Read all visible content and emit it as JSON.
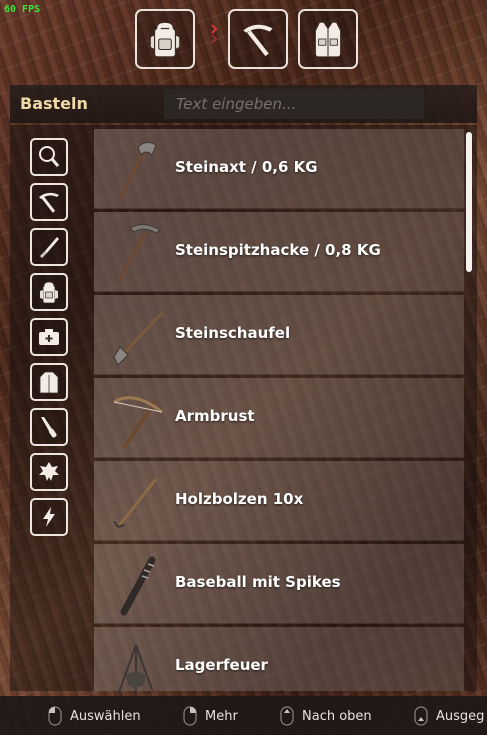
{
  "fps": "60 FPS",
  "tabs": [
    {
      "name": "backpack-icon"
    },
    {
      "name": "pickaxe-icon"
    },
    {
      "name": "vest-icon"
    }
  ],
  "panel": {
    "title": "Basteln",
    "search_placeholder": "Text eingeben..."
  },
  "categories": [
    {
      "name": "search-icon"
    },
    {
      "name": "tools-icon"
    },
    {
      "name": "knife-icon"
    },
    {
      "name": "backpack-icon"
    },
    {
      "name": "medkit-icon"
    },
    {
      "name": "jacket-icon"
    },
    {
      "name": "screwdriver-icon"
    },
    {
      "name": "leaf-icon"
    },
    {
      "name": "lightning-icon"
    }
  ],
  "items": [
    {
      "label": "Steinaxt / 0,6 KG",
      "icon": "stone-axe-icon"
    },
    {
      "label": "Steinspitzhacke / 0,8 KG",
      "icon": "stone-pickaxe-icon"
    },
    {
      "label": "Steinschaufel",
      "icon": "stone-shovel-icon"
    },
    {
      "label": "Armbrust",
      "icon": "crossbow-icon"
    },
    {
      "label": "Holzbolzen 10x",
      "icon": "wooden-bolt-icon"
    },
    {
      "label": "Baseball mit Spikes",
      "icon": "spiked-bat-icon"
    },
    {
      "label": "Lagerfeuer",
      "icon": "campfire-icon"
    }
  ],
  "hints": [
    {
      "label": "Auswählen",
      "icon": "mouse-left-icon"
    },
    {
      "label": "Mehr",
      "icon": "mouse-right-icon"
    },
    {
      "label": "Nach oben",
      "icon": "mouse-scroll-icon"
    },
    {
      "label": "Ausgeg",
      "icon": "mouse-icon"
    }
  ]
}
